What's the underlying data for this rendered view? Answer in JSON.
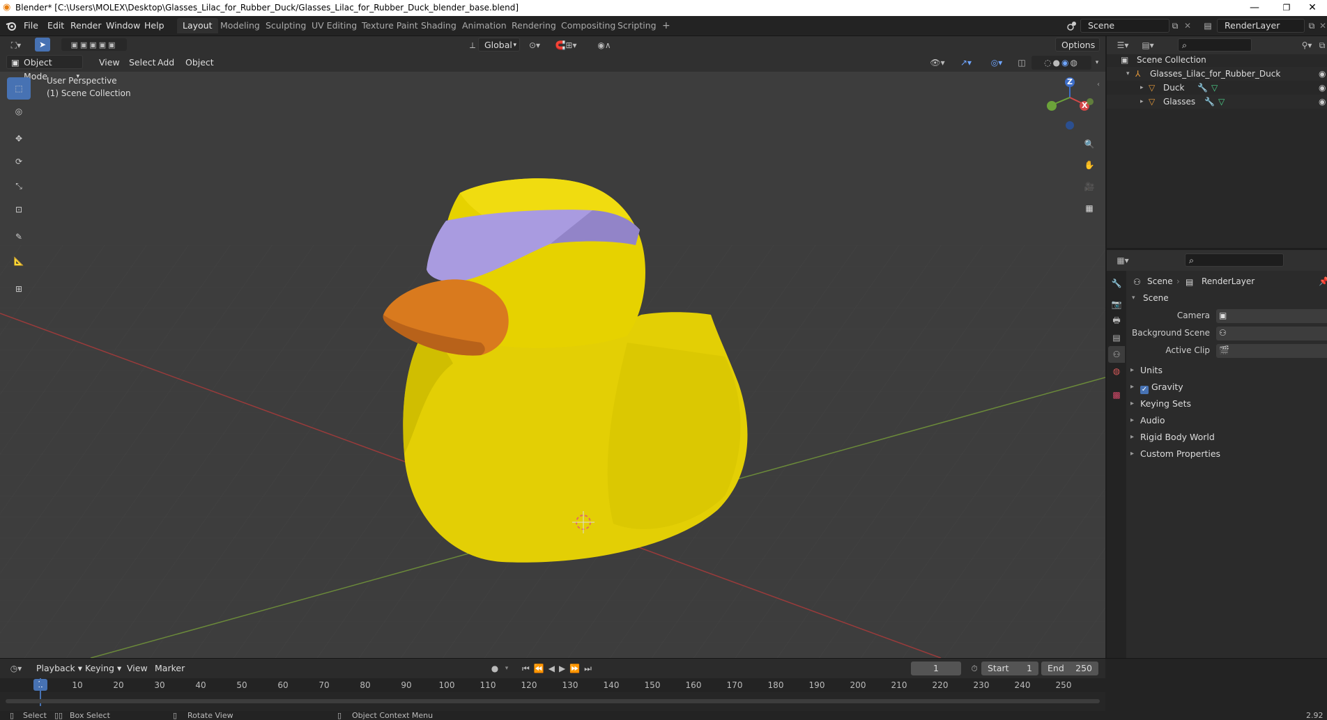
{
  "window": {
    "title": "Blender* [C:\\Users\\MOLEX\\Desktop\\Glasses_Lilac_for_Rubber_Duck/Glasses_Lilac_for_Rubber_Duck_blender_base.blend]",
    "minimize": "—",
    "maximize": "❐",
    "close": "✕"
  },
  "menubar": {
    "items": [
      "File",
      "Edit",
      "Render",
      "Window",
      "Help"
    ]
  },
  "workspaces": {
    "tabs": [
      "Layout",
      "Modeling",
      "Sculpting",
      "UV Editing",
      "Texture Paint",
      "Shading",
      "Animation",
      "Rendering",
      "Compositing",
      "Scripting"
    ],
    "active": "Layout",
    "add": "+"
  },
  "scene_selector": {
    "value": "Scene"
  },
  "viewlayer_selector": {
    "value": "RenderLayer"
  },
  "viewport_header": {
    "mode": "Object Mode",
    "menus": [
      "View",
      "Select",
      "Add",
      "Object"
    ],
    "transform_orientation": "Global",
    "options": "Options"
  },
  "viewport": {
    "overlay_line1": "User Perspective",
    "overlay_line2": "(1) Scene Collection",
    "gizmo": {
      "z": "Z",
      "y": "Y",
      "x": "X"
    }
  },
  "outliner": {
    "root": "Scene Collection",
    "collection": "Glasses_Lilac_for_Rubber_Duck",
    "objects": [
      "Duck",
      "Glasses"
    ]
  },
  "properties": {
    "breadcrumb_scene": "Scene",
    "breadcrumb_layer": "RenderLayer",
    "section": "Scene",
    "fields": {
      "camera_label": "Camera",
      "background_scene_label": "Background Scene",
      "active_clip_label": "Active Clip"
    },
    "panels": [
      "Units",
      "Gravity",
      "Keying Sets",
      "Audio",
      "Rigid Body World",
      "Custom Properties"
    ],
    "gravity_checked": true
  },
  "timeline": {
    "menus": [
      "Playback",
      "Keying",
      "View",
      "Marker"
    ],
    "current_frame": "1",
    "start_label": "Start",
    "start_value": "1",
    "end_label": "End",
    "end_value": "250",
    "ruler": [
      "1",
      "10",
      "20",
      "30",
      "40",
      "50",
      "60",
      "70",
      "80",
      "90",
      "100",
      "110",
      "120",
      "130",
      "140",
      "150",
      "160",
      "170",
      "180",
      "190",
      "200",
      "210",
      "220",
      "230",
      "240",
      "250"
    ]
  },
  "statusbar": {
    "select": "Select",
    "box_select": "Box Select",
    "rotate_view": "Rotate View",
    "context_menu": "Object Context Menu",
    "version": "2.92"
  },
  "colors": {
    "accent": "#4772b3",
    "duck_body": "#e6d200",
    "beak": "#d97a1e",
    "glasses": "#a99be0"
  }
}
